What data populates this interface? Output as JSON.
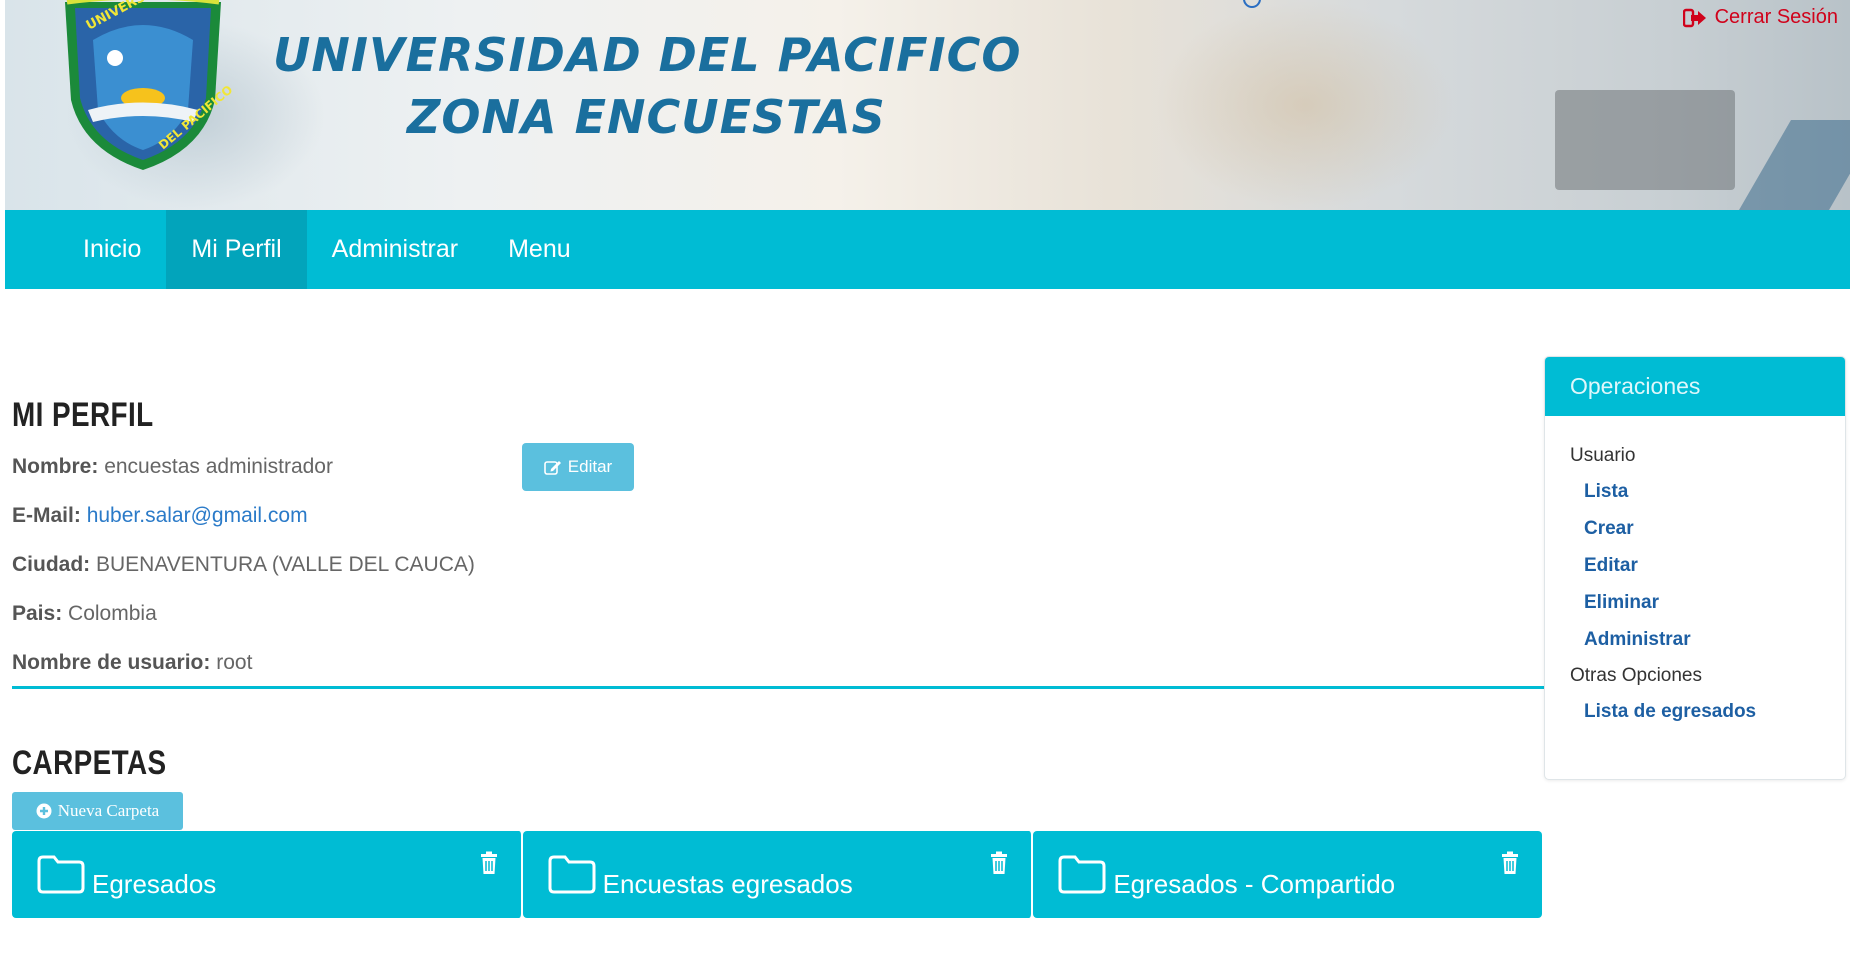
{
  "header": {
    "title_line1": "UNIVERSIDAD DEL PACIFICO",
    "title_line2": "ZONA ENCUESTAS",
    "logout_label": "Cerrar Sesión",
    "logout_icon": "sign-out-icon",
    "logo": "universidad-del-pacifico-shield-logo"
  },
  "nav": {
    "items": [
      {
        "label": "Inicio",
        "active": false
      },
      {
        "label": "Mi Perfil",
        "active": true
      },
      {
        "label": "Administrar",
        "active": false
      },
      {
        "label": "Menu",
        "active": false
      }
    ]
  },
  "profile": {
    "heading": "MI PERFIL",
    "edit_label": "Editar",
    "fields": [
      {
        "label": "Nombre:",
        "value": "encuestas administrador"
      },
      {
        "label": "E-Mail:",
        "value": "huber.salar@gmail.com"
      },
      {
        "label": "Ciudad:",
        "value": "BUENAVENTURA (VALLE DEL CAUCA)"
      },
      {
        "label": "Pais:",
        "value": "Colombia"
      },
      {
        "label": "Nombre de usuario:",
        "value": "root"
      }
    ]
  },
  "folders": {
    "heading": "CARPETAS",
    "new_label": "Nueva Carpeta",
    "items": [
      {
        "name": "Egresados"
      },
      {
        "name": "Encuestas egresados"
      },
      {
        "name": "Egresados - Compartido"
      }
    ]
  },
  "operations": {
    "title": "Operaciones",
    "group1": "Usuario",
    "group1_links": [
      "Lista",
      "Crear",
      "Editar",
      "Eliminar",
      "Administrar"
    ],
    "group2": "Otras Opciones",
    "group2_links": [
      "Lista de egresados"
    ]
  },
  "colors": {
    "accent": "#00bcd4",
    "accent_active": "#02a4bb",
    "button": "#5bc0de",
    "logout": "#d0021b",
    "link": "#2a7ac8"
  }
}
